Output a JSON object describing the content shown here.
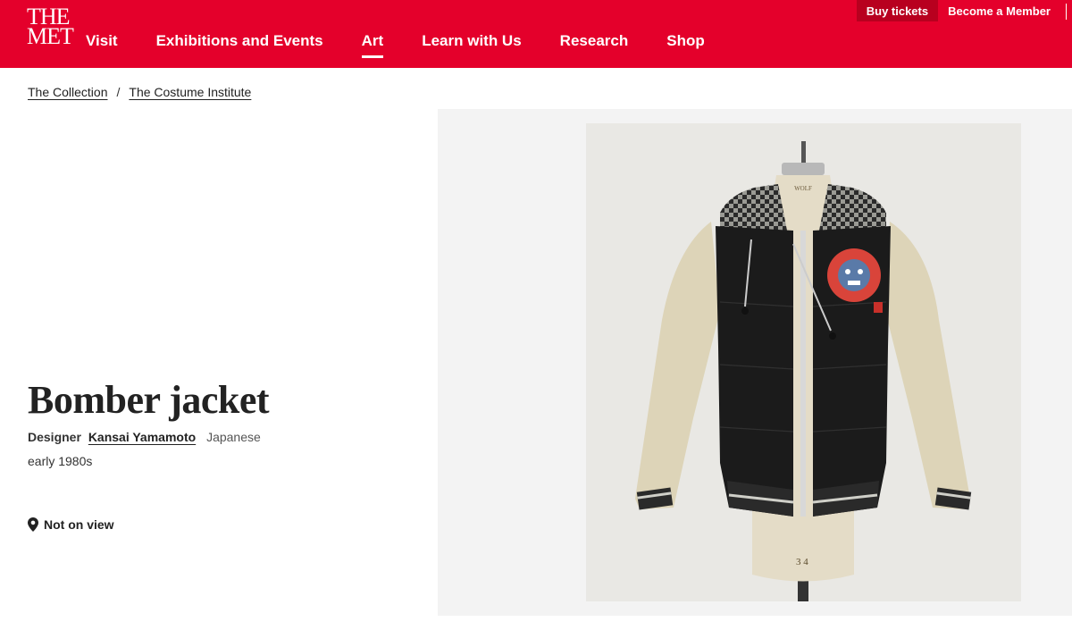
{
  "header": {
    "logo": {
      "line1": "THE",
      "line2": "MET"
    },
    "nav": [
      {
        "label": "Visit",
        "active": false
      },
      {
        "label": "Exhibitions and Events",
        "active": false
      },
      {
        "label": "Art",
        "active": true
      },
      {
        "label": "Learn with Us",
        "active": false
      },
      {
        "label": "Research",
        "active": false
      },
      {
        "label": "Shop",
        "active": false
      }
    ],
    "utility": {
      "buy_tickets": "Buy tickets",
      "become_member": "Become a Member"
    }
  },
  "breadcrumb": {
    "items": [
      "The Collection",
      "The Costume Institute"
    ],
    "separator": "/"
  },
  "object": {
    "title": "Bomber jacket",
    "designer_role": "Designer",
    "designer_name": "Kansai Yamamoto",
    "designer_nationality": "Japanese",
    "date": "early 1980s",
    "on_view_status": "Not on view"
  },
  "image": {
    "mannequin_text_top": "WOLF",
    "mannequin_size": "3 4"
  },
  "colors": {
    "brand_red": "#e4002b",
    "panel_bg": "#f3f3f3"
  }
}
